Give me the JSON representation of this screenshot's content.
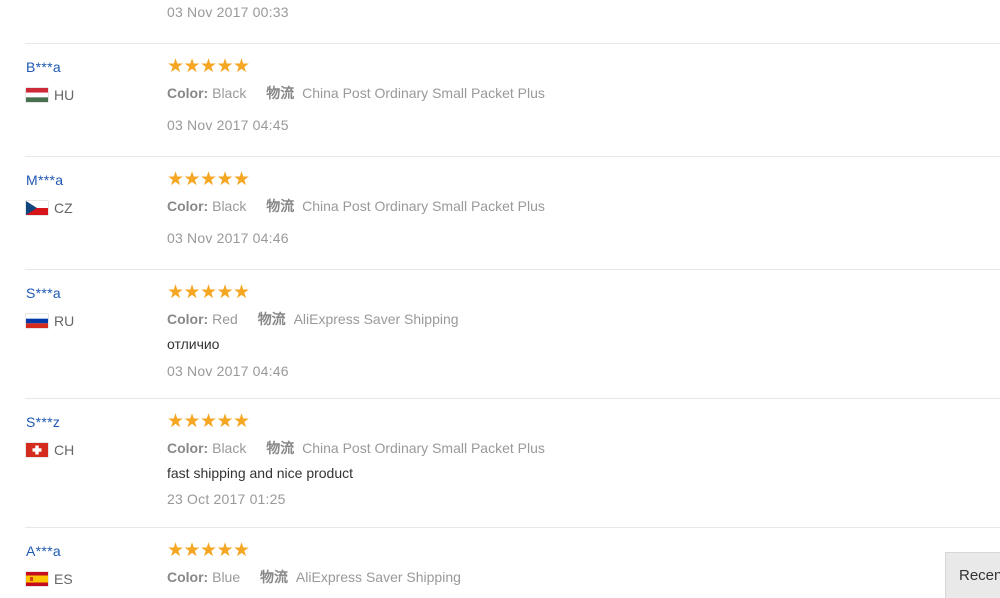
{
  "previous_review": {
    "date": "03 Nov 2017 00:33"
  },
  "labels": {
    "color_key": "Color:",
    "shipping_key": "物流"
  },
  "reviews": [
    {
      "user": "B***a",
      "country": "HU",
      "flag": "hungary",
      "rating": 5,
      "color": "Black",
      "shipping": "China Post Ordinary Small Packet Plus",
      "comment": "",
      "date": "03 Nov 2017 04:45"
    },
    {
      "user": "M***a",
      "country": "CZ",
      "flag": "czech",
      "rating": 5,
      "color": "Black",
      "shipping": "China Post Ordinary Small Packet Plus",
      "comment": "",
      "date": "03 Nov 2017 04:46"
    },
    {
      "user": "S***a",
      "country": "RU",
      "flag": "russia",
      "rating": 5,
      "color": "Red",
      "shipping": "AliExpress Saver Shipping",
      "comment": "отличио",
      "date": "03 Nov 2017 04:46"
    },
    {
      "user": "S***z",
      "country": "CH",
      "flag": "switzerland",
      "rating": 5,
      "color": "Black",
      "shipping": "China Post Ordinary Small Packet Plus",
      "comment": "fast shipping and nice product",
      "date": "23 Oct 2017 01:25"
    },
    {
      "user": "A***a",
      "country": "ES",
      "flag": "spain",
      "rating": 5,
      "color": "Blue",
      "shipping": "AliExpress Saver Shipping",
      "comment": "",
      "date": ""
    }
  ],
  "recent_tab": {
    "label": "Recen"
  },
  "colors": {
    "star": "#f5a623",
    "user_link": "#1e58b4",
    "muted_text": "#999999",
    "divider": "#e8e8e8"
  },
  "icons": {
    "star": "star-icon"
  }
}
